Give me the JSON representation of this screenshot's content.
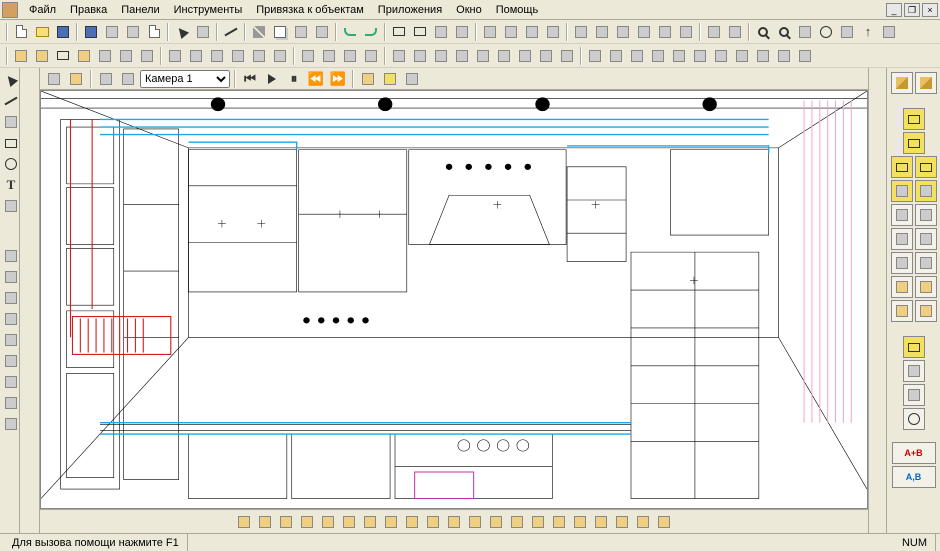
{
  "menu": {
    "items": [
      "Файл",
      "Правка",
      "Панели",
      "Инструменты",
      "Привязка к объектам",
      "Приложения",
      "Окно",
      "Помощь"
    ]
  },
  "window": {
    "minimize": "_",
    "restore": "❐",
    "close": "×"
  },
  "camera": {
    "selected": "Камера 1"
  },
  "status": {
    "help": "Для вызова помощи нажмите F1",
    "num": "NUM"
  },
  "right_panel": {
    "text_btn1": "A+B",
    "text_btn2": "A,B"
  }
}
